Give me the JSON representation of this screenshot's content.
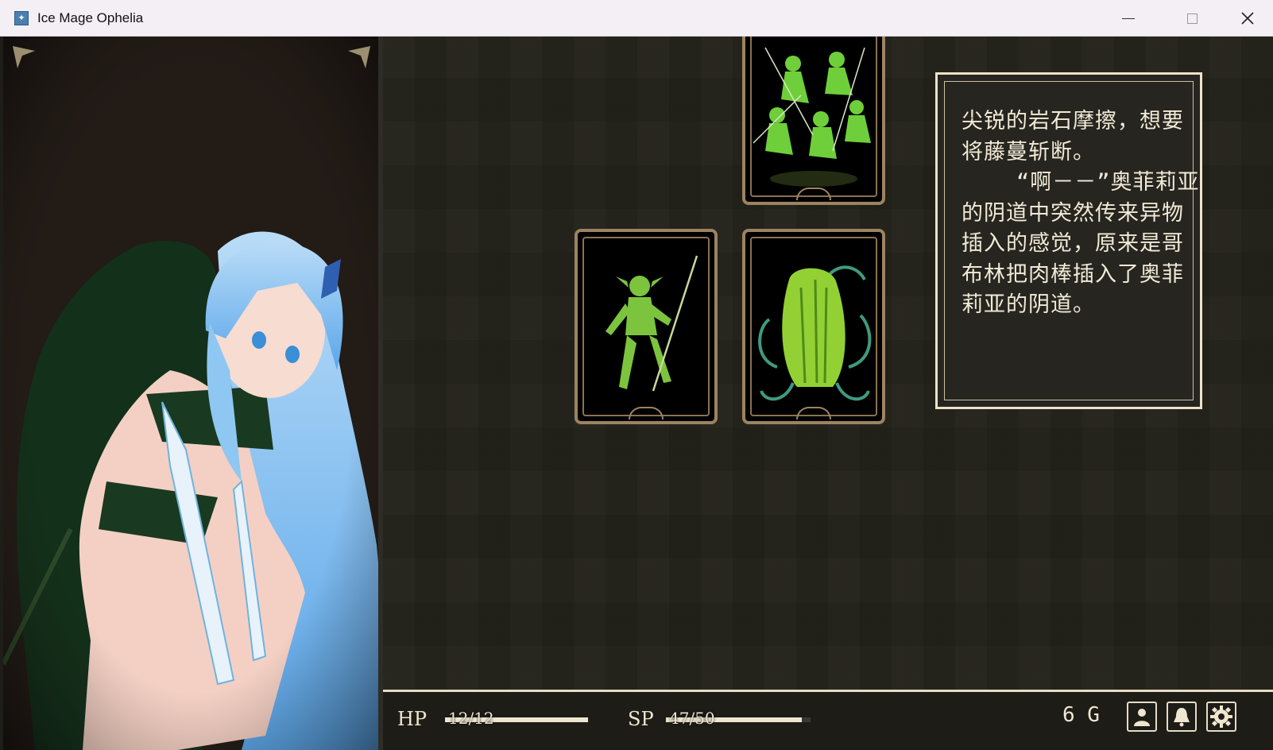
{
  "window": {
    "title": "Ice Mage Ophelia",
    "app_icon": "ice-mage-app-icon",
    "controls": [
      "minimize",
      "maximize",
      "close"
    ]
  },
  "cards": [
    {
      "name": "goblin-horde-card",
      "art": "pack of green goblins leaping with spears"
    },
    {
      "name": "goblin-spearman-card",
      "art": "single goblin holding a spear"
    },
    {
      "name": "tentacle-plant-card",
      "art": "green tentacle plant creature"
    }
  ],
  "message": {
    "text": "尖锐的岩石摩擦，想要将藤蔓斩断。\n    “啊－－”奥菲莉亚的阴道中突然传来异物插入的感觉，原来是哥布林把肉棒插入了奥菲莉亚的阴道。"
  },
  "status": {
    "hp_label": "HP",
    "hp_value": "12/12",
    "hp_fraction": 1.0,
    "sp_label": "SP",
    "sp_value": "47/50",
    "sp_fraction": 0.94,
    "gold": "6 G"
  },
  "icons": {
    "status_icon": "character-status-icon",
    "bell_icon": "bell-icon",
    "settings_icon": "gear-icon"
  },
  "colors": {
    "card_frame": "#9c8361",
    "text_light": "#efe6cf",
    "background": "#23221c"
  }
}
